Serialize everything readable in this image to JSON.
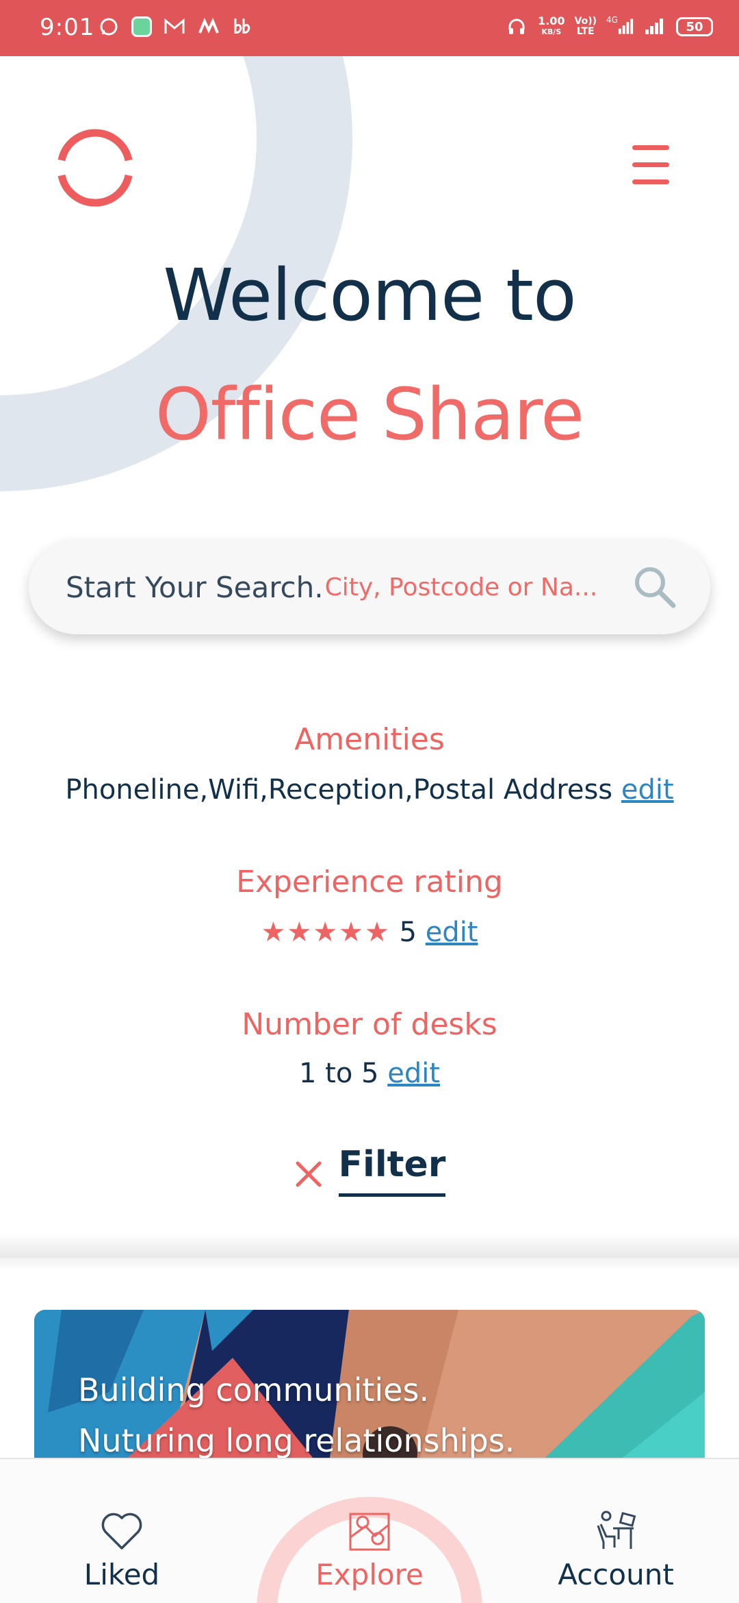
{
  "status_bar": {
    "time": "9:01",
    "net_speed_value": "1.00",
    "net_speed_unit": "KB/S",
    "volte_top": "Vo))",
    "volte_bottom": "LTE",
    "network": "4G",
    "battery": "50",
    "icons": [
      "whatsapp-icon",
      "app-icon",
      "gmail-icon",
      "m-app-icon",
      "bb-app-icon",
      "headset-icon",
      "signal-icon",
      "signal-icon"
    ]
  },
  "header": {
    "welcome_line": "Welcome to",
    "brand_line": "Office Share"
  },
  "search": {
    "label": "Start Your Search.",
    "placeholder": "City, Postcode or Na..."
  },
  "filters": {
    "amenities": {
      "title": "Amenities",
      "value": "Phoneline,Wifi,Reception,Postal Address",
      "edit": "edit"
    },
    "experience": {
      "title": "Experience rating",
      "stars": "★★★★★",
      "rating": 5,
      "value": "5",
      "edit": "edit"
    },
    "desks": {
      "title": "Number of desks",
      "value": "1 to 5",
      "edit": "edit"
    },
    "filter_label": "Filter"
  },
  "banner": {
    "line1": "Building communities.",
    "line2": "Nuturing long relationships."
  },
  "bottom_nav": {
    "items": [
      {
        "label": "Liked",
        "icon": "heart-icon"
      },
      {
        "label": "Explore",
        "icon": "map-icon",
        "active": true
      },
      {
        "label": "Account",
        "icon": "desk-user-icon"
      }
    ]
  },
  "colors": {
    "status_bar": "#df5558",
    "accent": "#ee6462",
    "navy": "#12304a",
    "link": "#2d86c4",
    "arc": "#dfe6ee"
  }
}
